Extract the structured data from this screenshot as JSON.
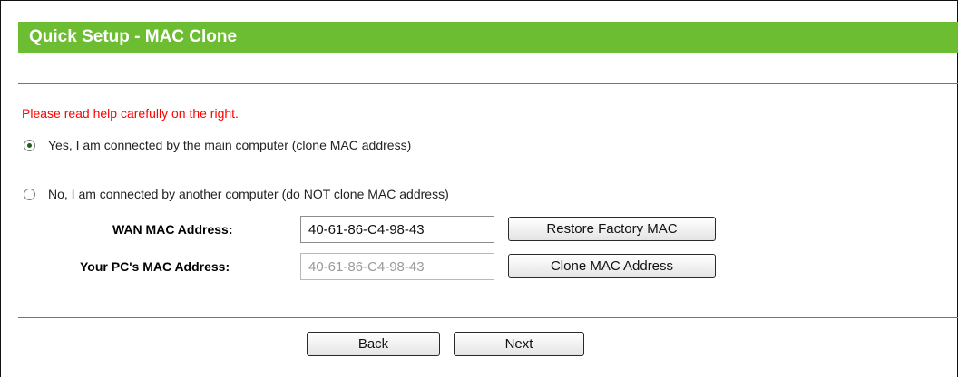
{
  "title": "Quick Setup - MAC Clone",
  "hint": "Please read help carefully on the right.",
  "options": {
    "clone": {
      "label": "Yes, I am connected by the main computer (clone MAC address)",
      "checked": true
    },
    "no_clone": {
      "label": "No, I am connected by another computer (do NOT clone MAC address)",
      "checked": false
    }
  },
  "fields": {
    "wan_mac": {
      "label": "WAN MAC Address:",
      "value": "40-61-86-C4-98-43"
    },
    "pc_mac": {
      "label": "Your PC's MAC Address:",
      "value": "40-61-86-C4-98-43"
    }
  },
  "buttons": {
    "restore": "Restore Factory MAC",
    "clone": "Clone MAC Address",
    "back": "Back",
    "next": "Next"
  },
  "colors": {
    "title_bar": "#6cbd31",
    "hint": "#ff0000",
    "rule": "#3d9a3d"
  }
}
